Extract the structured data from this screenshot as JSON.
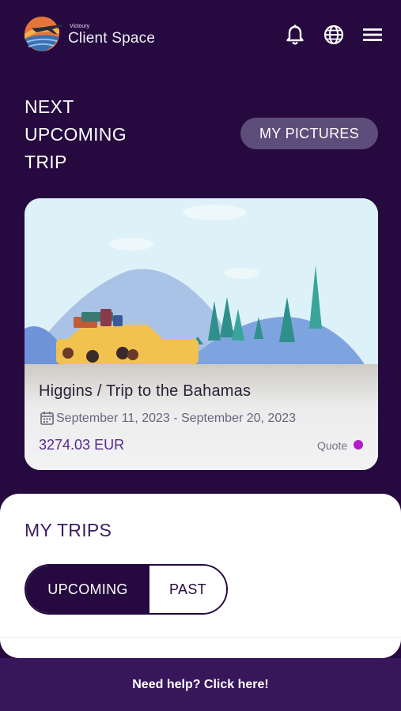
{
  "header": {
    "brand_small": "Victoury",
    "brand_name": "Client Space",
    "icons": [
      "plane-logo-icon",
      "bell-icon",
      "globe-icon",
      "menu-icon"
    ]
  },
  "hero": {
    "title_line1": "NEXT",
    "title_line2": "UPCOMING",
    "title_line3": "TRIP",
    "pictures_button": "MY PICTURES"
  },
  "trip_card": {
    "name": "Higgins / Trip to the Bahamas",
    "dates": "September 11, 2023 - September 20, 2023",
    "price": "3274.03 EUR",
    "status": "Quote",
    "status_color": "#b21cc9"
  },
  "my_trips": {
    "title": "MY TRIPS",
    "tabs": [
      "UPCOMING",
      "PAST"
    ],
    "selected_tab": "UPCOMING"
  },
  "footer": {
    "help_text": "Need help? Click here!"
  },
  "colors": {
    "background": "#25093f",
    "accent": "#5a2a8a",
    "footer": "#37165a"
  }
}
